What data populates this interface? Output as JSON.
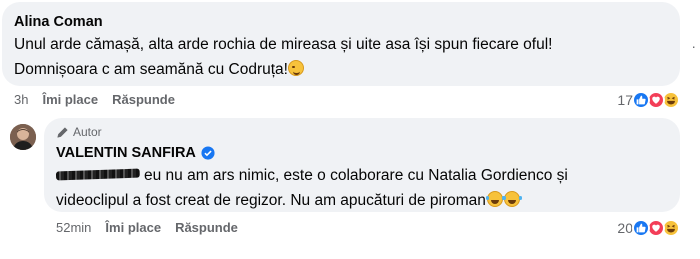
{
  "comment1": {
    "author": "Alina Coman",
    "line1": "Unul arde cămașă, alta arde rochia de mireasa și uite asa își spun fiecare oful!",
    "line2": "Domnișoara c am seamănă cu Codruța!",
    "emoji": "wink-emoji",
    "time": "3h",
    "like_label": "Îmi place",
    "reply_label": "Răspunde",
    "reaction_count": "17",
    "reactions": [
      "like-icon",
      "love-icon",
      "haha-icon"
    ]
  },
  "comment2": {
    "badge": "Autor",
    "author": "VALENTIN SANFIRA",
    "verified": true,
    "line1": "eu nu am ars nimic, este o colaborare cu Natalia Gordienco și",
    "line2": "videoclipul a fost creat de regizor. Nu am apucături de piroman",
    "emojis": [
      "laughing-emoji",
      "laughing-emoji"
    ],
    "time": "52min",
    "like_label": "Îmi place",
    "reply_label": "Răspunde",
    "reaction_count": "20",
    "reactions": [
      "like-icon",
      "love-icon",
      "haha-icon"
    ]
  },
  "more_menu": "·",
  "colors": {
    "bubble": "#f0f2f5",
    "meta_text": "#65676b",
    "like": "#1877f2",
    "love": "#f33e58",
    "haha": "#f7c23b"
  }
}
